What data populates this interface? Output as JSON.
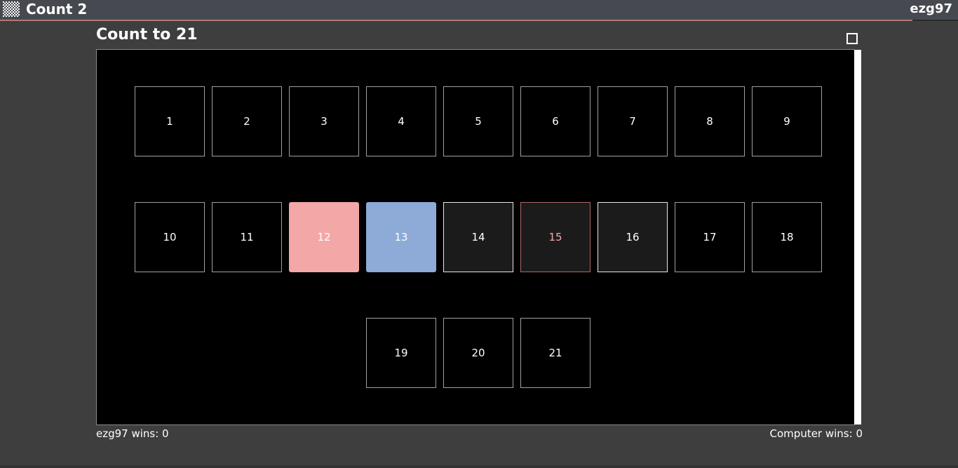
{
  "header": {
    "app_title": "Count 2",
    "username": "ezg97",
    "app_icon": "checkerboard-icon"
  },
  "game": {
    "title": "Count to 21",
    "maximize_icon": "maximize-icon",
    "cells": [
      {
        "label": "1",
        "state": "unplayed"
      },
      {
        "label": "2",
        "state": "unplayed"
      },
      {
        "label": "3",
        "state": "unplayed"
      },
      {
        "label": "4",
        "state": "unplayed"
      },
      {
        "label": "5",
        "state": "unplayed"
      },
      {
        "label": "6",
        "state": "unplayed"
      },
      {
        "label": "7",
        "state": "unplayed"
      },
      {
        "label": "8",
        "state": "unplayed"
      },
      {
        "label": "9",
        "state": "unplayed"
      },
      {
        "label": "10",
        "state": "unplayed"
      },
      {
        "label": "11",
        "state": "unplayed"
      },
      {
        "label": "12",
        "state": "played-red"
      },
      {
        "label": "13",
        "state": "played-blue"
      },
      {
        "label": "14",
        "state": "available"
      },
      {
        "label": "15",
        "state": "available-highlight"
      },
      {
        "label": "16",
        "state": "available"
      },
      {
        "label": "17",
        "state": "unplayed"
      },
      {
        "label": "18",
        "state": "unplayed"
      },
      {
        "label": "19",
        "state": "unplayed"
      },
      {
        "label": "20",
        "state": "unplayed"
      },
      {
        "label": "21",
        "state": "unplayed"
      }
    ]
  },
  "scores": {
    "player": "ezg97 wins: 0",
    "computer": "Computer wins: 0"
  },
  "colors": {
    "player_red": "#f4a7a7",
    "computer_blue": "#8eaad6",
    "header_accent": "#b07a74"
  }
}
